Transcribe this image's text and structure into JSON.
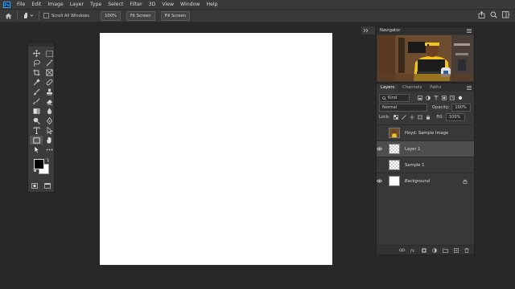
{
  "app": {
    "logo": "Ps"
  },
  "menu": [
    "File",
    "Edit",
    "Image",
    "Layer",
    "Type",
    "Select",
    "Filter",
    "3D",
    "View",
    "Window",
    "Help"
  ],
  "options": {
    "scroll_all_label": "Scroll All Windows",
    "zoom_100_label": "100%",
    "fit_screen_label": "Fit Screen",
    "fill_screen_label": "Fill Screen"
  },
  "navigator": {
    "title": "Navigator"
  },
  "layers_panel": {
    "tabs": [
      "Layers",
      "Channels",
      "Paths"
    ],
    "filter_kind": "Kind",
    "blend_mode": "Normal",
    "opacity_label": "Opacity:",
    "opacity_value": "100%",
    "lock_label": "Lock:",
    "fill_label": "Fill:",
    "fill_value": "100%",
    "layers": [
      {
        "name": "Hoyd: Sample Image",
        "visible": false,
        "thumb": "photo"
      },
      {
        "name": "Layer 1",
        "visible": true,
        "selected": true,
        "thumb": "transparent"
      },
      {
        "name": "Sample 1",
        "visible": false,
        "thumb": "transparent"
      },
      {
        "name": "Background",
        "visible": true,
        "thumb": "white",
        "locked": true
      }
    ]
  },
  "colors": {
    "foreground": "#000000",
    "background": "#ffffff",
    "accent": "#31a8ff"
  }
}
